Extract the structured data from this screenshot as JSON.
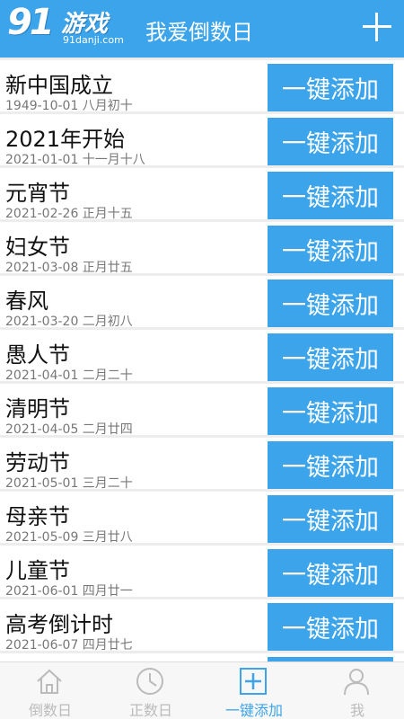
{
  "header": {
    "logo_big": "91",
    "logo_cn": "游戏",
    "logo_url": "91danji.com",
    "title": "我爱倒数日"
  },
  "button_label": "一键添加",
  "items": [
    {
      "title": "新中国成立",
      "date": "1949-10-01 八月初十"
    },
    {
      "title": "2021年开始",
      "date": "2021-01-01 十一月十八"
    },
    {
      "title": "元宵节",
      "date": "2021-02-26 正月十五"
    },
    {
      "title": "妇女节",
      "date": "2021-03-08 正月廿五"
    },
    {
      "title": "春风",
      "date": "2021-03-20 二月初八"
    },
    {
      "title": "愚人节",
      "date": "2021-04-01 二月二十"
    },
    {
      "title": "清明节",
      "date": "2021-04-05 二月廿四"
    },
    {
      "title": "劳动节",
      "date": "2021-05-01 三月二十"
    },
    {
      "title": "母亲节",
      "date": "2021-05-09 三月廿八"
    },
    {
      "title": "儿童节",
      "date": "2021-06-01 四月廿一"
    },
    {
      "title": "高考倒计时",
      "date": "2021-06-07 四月廿七"
    }
  ],
  "tabs": [
    {
      "label": "倒数日",
      "icon": "home-icon",
      "active": false
    },
    {
      "label": "正数日",
      "icon": "clock-icon",
      "active": false
    },
    {
      "label": "一键添加",
      "icon": "add-box-icon",
      "active": true
    },
    {
      "label": "我",
      "icon": "user-icon",
      "active": false
    }
  ],
  "colors": {
    "accent": "#3ca4ea",
    "tab_inactive": "#bbbbbb"
  }
}
